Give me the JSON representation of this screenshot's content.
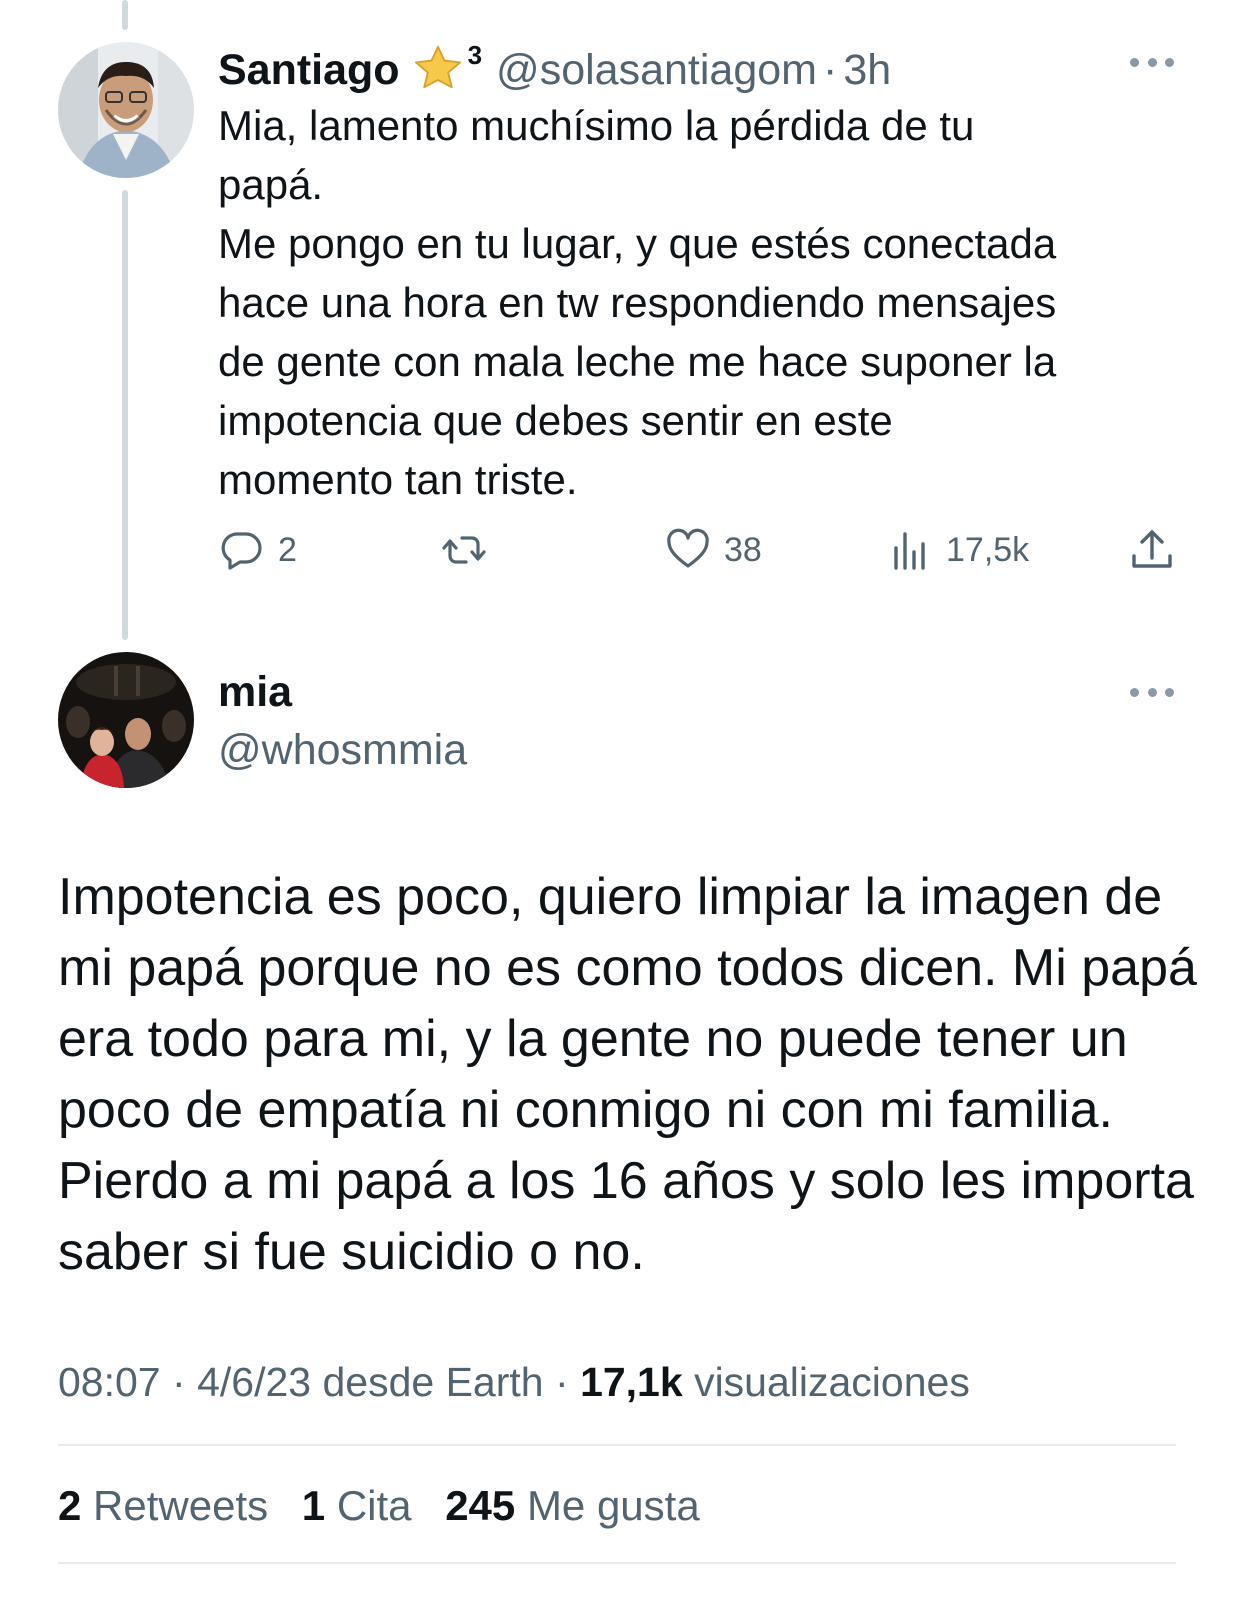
{
  "reply": {
    "name": "Santiago",
    "badge_icon": "star-emoji",
    "badge_sup": "3",
    "handle": "@solasantiagom",
    "separator": "·",
    "time": "3h",
    "text_lines": [
      "Mia, lamento muchísimo la pérdida de tu",
      "papá.",
      "Me pongo en tu lugar, y que estés conectada",
      "hace una hora en tw respondiendo mensajes",
      "de gente con mala leche me hace suponer la",
      "impotencia que debes sentir en este",
      "momento tan triste."
    ],
    "actions": {
      "replies": "2",
      "retweets": "",
      "likes": "38",
      "views": "17,5k"
    }
  },
  "tweet": {
    "name": "mia",
    "handle": "@whosmmia",
    "text": "Impotencia es poco, quiero limpiar la imagen de mi papá porque no es como todos dicen. Mi papá era todo para mi, y la gente no puede tener un poco de empatía ni conmigo ni con mi familia. Pierdo a mi papá a los 16 años y solo les importa saber si fue suicidio o no.",
    "time": "08:07",
    "date": "4/6/23",
    "source": "desde Earth",
    "separator": "·",
    "views_count": "17,1k",
    "views_label": "visualizaciones",
    "stats": {
      "retweets_count": "2",
      "retweets_label": "Retweets",
      "quotes_count": "1",
      "quotes_label": "Cita",
      "likes_count": "245",
      "likes_label": "Me gusta"
    }
  },
  "colors": {
    "text_primary": "#0f1419",
    "text_secondary": "#536471",
    "thread_line": "#cfd9de",
    "divider": "#e6ecf0"
  }
}
